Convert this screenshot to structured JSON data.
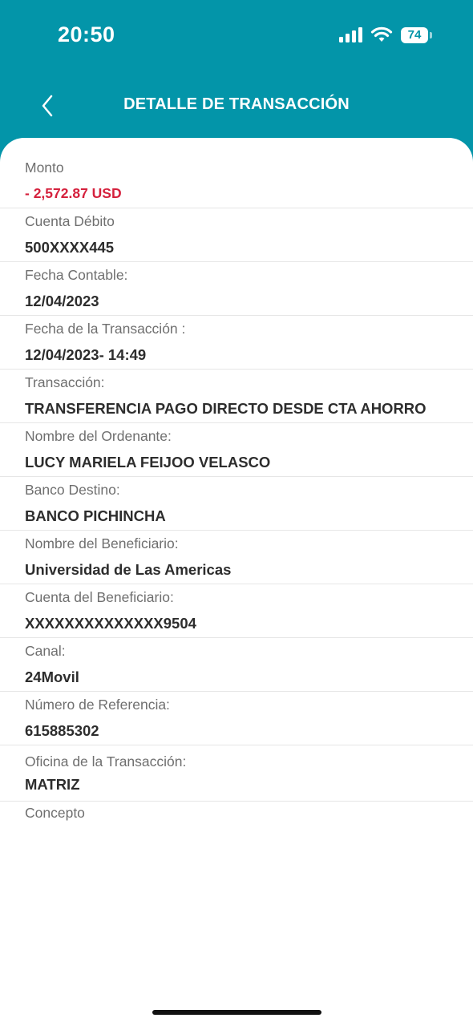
{
  "status_bar": {
    "time": "20:50",
    "battery": "74"
  },
  "header": {
    "title": "DETALLE DE TRANSACCIÓN"
  },
  "details": [
    {
      "label": "Monto",
      "value": "- 2,572.87 USD"
    },
    {
      "label": "Cuenta Débito",
      "value": "500XXXX445"
    },
    {
      "label": "Fecha Contable:",
      "value": "12/04/2023"
    },
    {
      "label": "Fecha de la Transacción :",
      "value": "12/04/2023- 14:49"
    },
    {
      "label": "Transacción:",
      "value": "TRANSFERENCIA PAGO DIRECTO DESDE CTA AHORRO"
    },
    {
      "label": "Nombre del Ordenante:",
      "value": "LUCY MARIELA FEIJOO VELASCO"
    },
    {
      "label": "Banco Destino:",
      "value": "BANCO PICHINCHA"
    },
    {
      "label": "Nombre del Beneficiario:",
      "value": "Universidad de Las Americas"
    },
    {
      "label": "Cuenta del Beneficiario:",
      "value": "XXXXXXXXXXXXXX9504"
    },
    {
      "label": "Canal:",
      "value": "24Movil"
    },
    {
      "label": "Número de Referencia:",
      "value": "615885302"
    },
    {
      "label": "Oficina de la Transacción:",
      "value": "MATRIZ"
    },
    {
      "label": "Concepto",
      "value": ""
    }
  ],
  "colors": {
    "brand": "#0395a9",
    "amount_negative": "#d5213d"
  },
  "icons": {
    "back": "chevron-left-icon",
    "signal": "cellular-signal-icon",
    "wifi": "wifi-icon",
    "battery": "battery-icon"
  }
}
